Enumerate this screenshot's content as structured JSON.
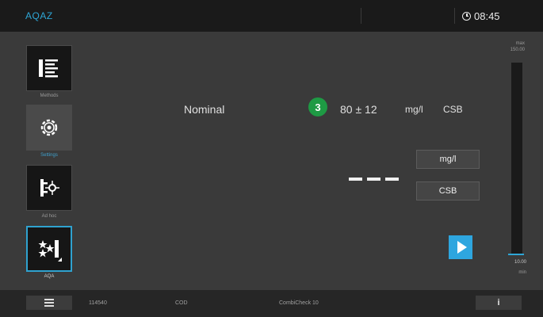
{
  "header": {
    "app_name": "AQAZ",
    "time": "08:45"
  },
  "sidebar": {
    "items": [
      {
        "label": "Methods",
        "icon": "method-list-icon",
        "active": false
      },
      {
        "label": "Settings",
        "icon": "gear-icon",
        "active": false
      },
      {
        "label": "Ad hoc",
        "icon": "adhoc-icon",
        "active": false
      },
      {
        "label": "AQA",
        "icon": "aqa-stars-icon",
        "active": true
      }
    ]
  },
  "main": {
    "nominal_label": "Nominal",
    "step_number": "3",
    "nominal_value": "80 ± 12",
    "nominal_unit": "mg/l",
    "nominal_parameter": "CSB",
    "result_display": "- - -",
    "unit_button_label": "mg/l",
    "parameter_button_label": "CSB"
  },
  "scale": {
    "max_label": "max",
    "max_value": "150.00",
    "min_value": "10.00",
    "min_label": "min"
  },
  "statusbar": {
    "test_number": "114540",
    "parameter": "COD",
    "standard": "CombiCheck 10",
    "info_label": "i"
  },
  "colors": {
    "accent": "#2ea6d6",
    "step_badge": "#1e9a44",
    "background": "#3a3a3a"
  }
}
